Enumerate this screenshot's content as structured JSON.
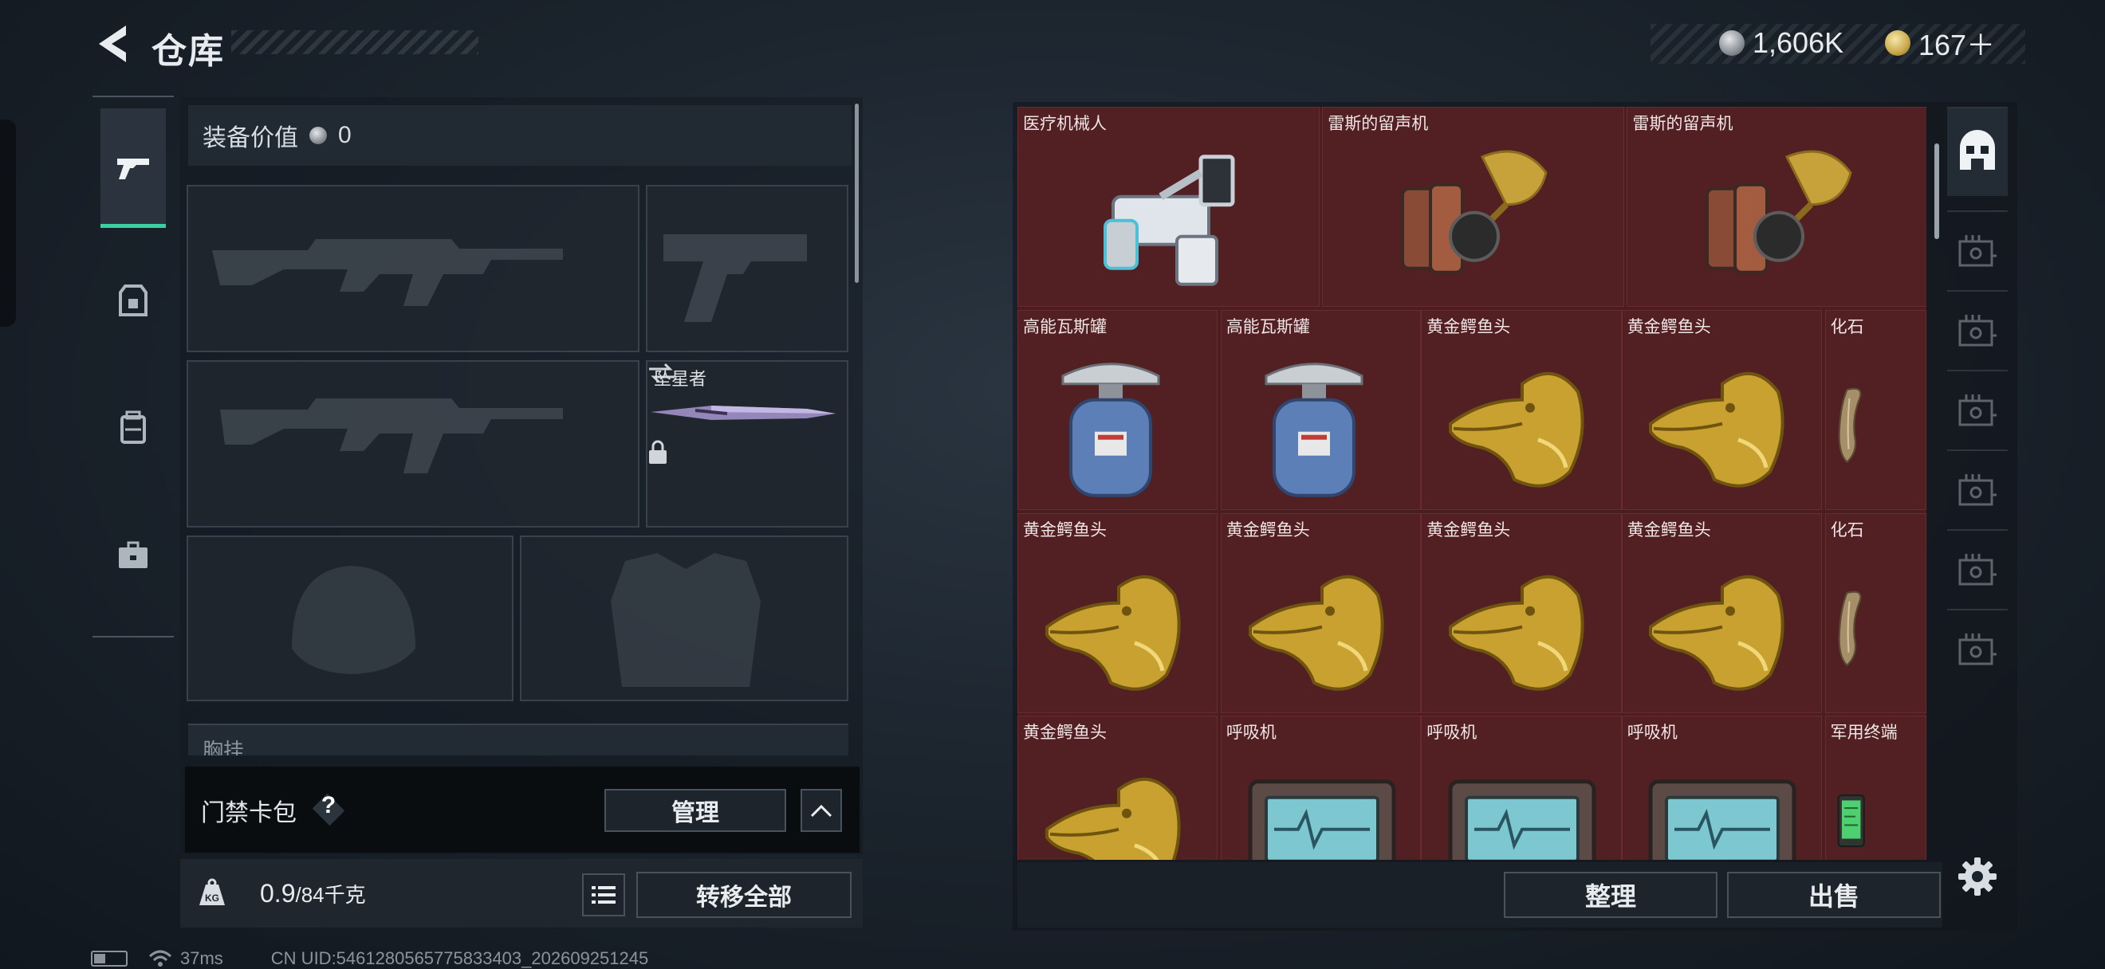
{
  "header": {
    "title": "仓库",
    "silver_amount": "1,606K",
    "gold_amount": "167＋"
  },
  "left_panel": {
    "equip_value_label": "装备价值",
    "equip_value": "0",
    "melee_slot_label": "坠星者",
    "chest_rig_label": "胸挂",
    "card_pack_label": "门禁卡包",
    "card_help": "?",
    "manage_label": "管理",
    "weight_value": "0.9",
    "weight_unit": "/84千克",
    "transfer_all_label": "转移全部"
  },
  "storage": {
    "items": [
      {
        "name": "医疗机械人",
        "icon": "medical-robot-icon"
      },
      {
        "name": "雷斯的留声机",
        "icon": "gramophone-icon"
      },
      {
        "name": "雷斯的留声机",
        "icon": "gramophone-icon"
      },
      {
        "name": "高能瓦斯罐",
        "icon": "gas-canister-icon"
      },
      {
        "name": "高能瓦斯罐",
        "icon": "gas-canister-icon"
      },
      {
        "name": "黄金鳄鱼头",
        "icon": "golden-crocodile-head-icon"
      },
      {
        "name": "黄金鳄鱼头",
        "icon": "golden-crocodile-head-icon"
      },
      {
        "name": "化石",
        "icon": "fossil-claw-icon"
      },
      {
        "name": "黄金鳄鱼头",
        "icon": "golden-crocodile-head-icon"
      },
      {
        "name": "黄金鳄鱼头",
        "icon": "golden-crocodile-head-icon"
      },
      {
        "name": "黄金鳄鱼头",
        "icon": "golden-crocodile-head-icon"
      },
      {
        "name": "黄金鳄鱼头",
        "icon": "golden-crocodile-head-icon"
      },
      {
        "name": "化石",
        "icon": "fossil-claw-icon"
      },
      {
        "name": "黄金鳄鱼头",
        "icon": "golden-crocodile-head-icon"
      },
      {
        "name": "呼吸机",
        "icon": "ventilator-icon"
      },
      {
        "name": "呼吸机",
        "icon": "ventilator-icon"
      },
      {
        "name": "呼吸机",
        "icon": "ventilator-icon"
      },
      {
        "name": "军用终端",
        "icon": "military-terminal-icon"
      }
    ],
    "sort_label": "整理",
    "sell_label": "出售"
  },
  "status_bar": {
    "ping": "37ms",
    "uid": "CN UID:5461280565775833403_202609251245"
  },
  "colors": {
    "accent": "#3cd0a0",
    "grid_bg": "#521f23",
    "gold": "#c9a84b"
  }
}
